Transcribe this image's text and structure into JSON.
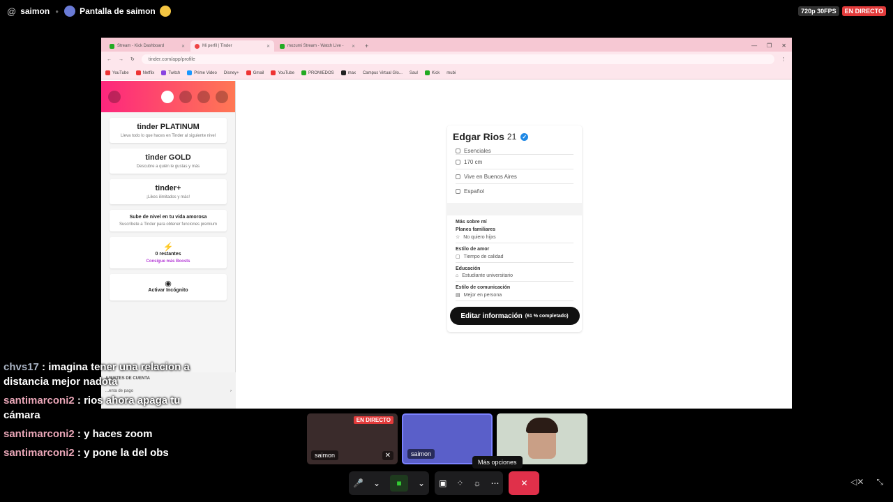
{
  "top": {
    "host": "saimon",
    "screen_label": "Pantalla de saimon",
    "quality": "720p 30FPS",
    "live": "EN DIRECTO"
  },
  "browser": {
    "tabs": [
      "Stream - Kick Dashboard",
      "Mi perfil | Tinder",
      "mozumi Stream - Watch Live -"
    ],
    "url": "tinder.com/app/profile",
    "bookmarks": [
      "YouTube",
      "Netflix",
      "Twitch",
      "Prime Video",
      "Disney+",
      "Gmail",
      "YouTube",
      "PROMIEDOS",
      "max",
      "Campus Virtual Glo...",
      "Saul",
      "Kick",
      "mubi"
    ]
  },
  "sidebar": {
    "cards": [
      {
        "logo": "tinder PLATINUM",
        "text": "Lleva todo lo que haces en Tinder al siguiente nivel"
      },
      {
        "logo": "tinder GOLD",
        "text": "Descubre a quién le gustas y más"
      },
      {
        "logo": "tinder+",
        "text": "¡Likes ilimitados y más!"
      }
    ],
    "levelup": {
      "title": "Sube de nivel en tu vida amorosa",
      "text": "Suscríbete a Tinder para obtener funciones premium"
    },
    "boost": {
      "count": "0 restantes",
      "link": "Consigue más Boosts"
    },
    "incognito": "Activar Incógnito",
    "settings_header": "AJUSTES DE CUENTA",
    "settings_row": "...enta de pago"
  },
  "profile": {
    "name": "Edgar Rios",
    "age": "21",
    "rows": [
      "Esenciales",
      "170 cm",
      "Vive en Buenos Aires",
      "Español"
    ],
    "more_header": "Más sobre mí",
    "items": [
      {
        "label": "Planes familiares",
        "value": "No quiero hijxs"
      },
      {
        "label": "Estilo de amor",
        "value": "Tiempo de calidad"
      },
      {
        "label": "Educación",
        "value": "Estudiante universitario"
      },
      {
        "label": "Estilo de comunicación",
        "value": "Mejor en persona"
      }
    ],
    "edit_button": "Editar información",
    "edit_note": "(61 % completado)"
  },
  "call": {
    "tiles": [
      {
        "name": "saimon",
        "live": "EN DIRECTO"
      },
      {
        "name": "saimon"
      }
    ],
    "tooltip": "Más opciones",
    "overlay_tag": "saimon"
  },
  "chat": [
    {
      "user": "chvs17",
      "msg": "imagina tener una relacion a distancia mejor nadota"
    },
    {
      "user": "santimarconi2",
      "msg": "rios ahora apaga tu cámara"
    },
    {
      "user": "santimarconi2",
      "msg": "y haces zoom"
    },
    {
      "user": "santimarconi2",
      "msg": "y pone la del obs"
    }
  ]
}
